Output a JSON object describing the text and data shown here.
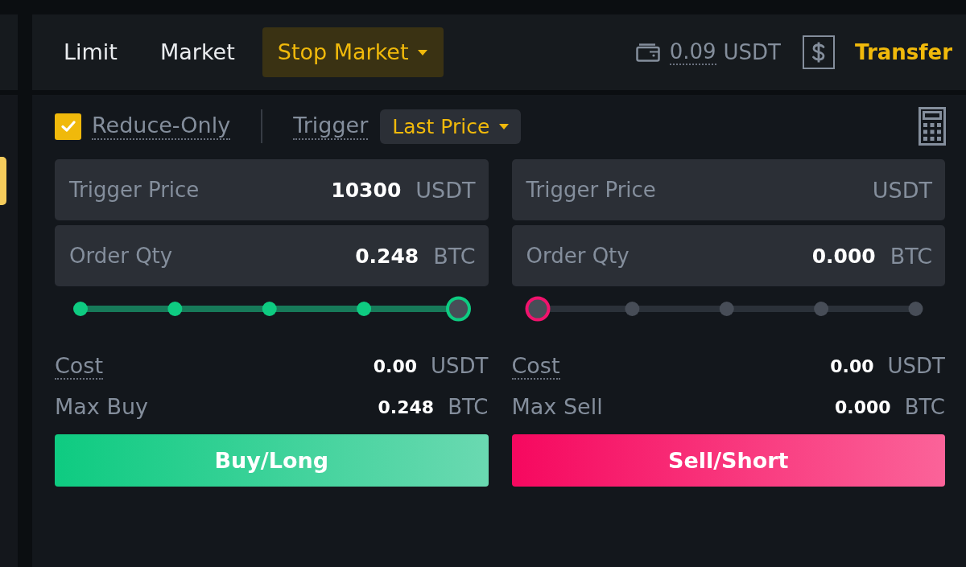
{
  "order_types": [
    {
      "label": "Limit",
      "selected": false,
      "kind": "plain"
    },
    {
      "label": "Market",
      "selected": false,
      "kind": "plain"
    },
    {
      "label": "Stop Market",
      "selected": true,
      "kind": "dropdown"
    }
  ],
  "balance": {
    "amount": "0.09",
    "unit": "USDT"
  },
  "transfer_label": "Transfer",
  "reduce_only": {
    "label": "Reduce-Only",
    "checked": true
  },
  "trigger": {
    "label": "Trigger",
    "value": "Last Price"
  },
  "sides": [
    {
      "kind": "buy",
      "fields": [
        {
          "label": "Trigger Price",
          "value": "10300",
          "unit": "USDT"
        },
        {
          "label": "Order Qty",
          "value": "0.248",
          "unit": "BTC"
        }
      ],
      "slider": {
        "level": 1
      },
      "cost": {
        "label": "Cost",
        "value": "0.00",
        "unit": "USDT"
      },
      "max": {
        "label": "Max Buy",
        "value": "0.248",
        "unit": "BTC"
      },
      "button": "Buy/Long"
    },
    {
      "kind": "sell",
      "fields": [
        {
          "label": "Trigger Price",
          "unit": "USDT"
        },
        {
          "label": "Order Qty",
          "value": "0.000",
          "unit": "BTC"
        }
      ],
      "slider": {
        "level": 0
      },
      "cost": {
        "label": "Cost",
        "value": "0.00",
        "unit": "USDT"
      },
      "max": {
        "label": "Max Sell",
        "value": "0.000",
        "unit": "BTC"
      },
      "button": "Sell/Short"
    }
  ]
}
